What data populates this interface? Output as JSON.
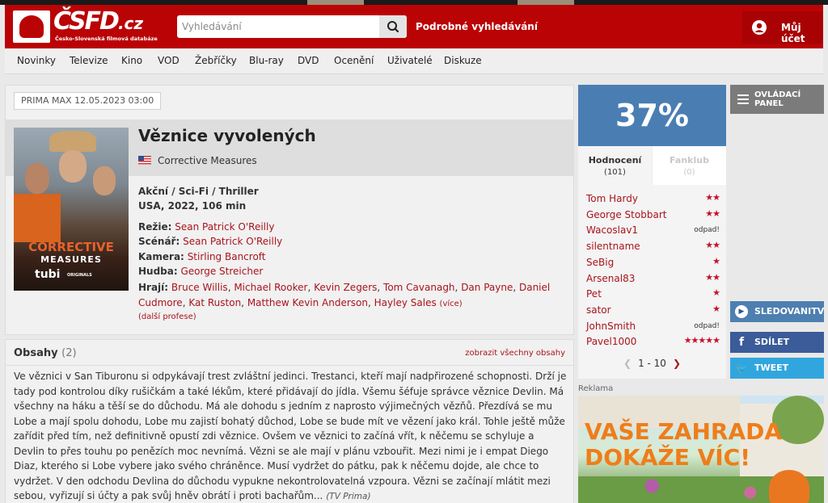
{
  "header": {
    "logo_text": "ČSFD",
    "logo_tld": ".cz",
    "logo_sub": "Česko-Slovenská filmová databáze",
    "search_placeholder": "Vyhledávání",
    "advanced_search": "Podrobné vyhledávání",
    "account": "Můj účet"
  },
  "nav": [
    "Novinky",
    "Televize",
    "Kino",
    "VOD",
    "Žebříčky",
    "Blu-ray",
    "DVD",
    "Ocenění",
    "Uživatelé",
    "Diskuze"
  ],
  "film": {
    "tv_badge": "PRIMA MAX 12.05.2023 03:00",
    "title": "Věznice vyvolených",
    "original_title": "Corrective Measures",
    "poster_title_1": "CORRECTIVE",
    "poster_title_2": "MEASURES",
    "poster_brand": "tubi",
    "poster_brand_sub": "ORIGINALS",
    "genres": "Akční / Sci-Fi / Thriller",
    "origin": "USA, 2022, 106 min",
    "crew": [
      {
        "label": "Režie:",
        "value": "Sean Patrick O'Reilly"
      },
      {
        "label": "Scénář:",
        "value": "Sean Patrick O'Reilly"
      },
      {
        "label": "Kamera:",
        "value": "Stirling Bancroft"
      },
      {
        "label": "Hudba:",
        "value": "George Streicher"
      }
    ],
    "actors_label": "Hrají:",
    "actors": [
      "Bruce Willis",
      "Michael Rooker",
      "Kevin Zegers",
      "Tom Cavanagh",
      "Dan Payne",
      "Daniel Cudmore",
      "Kat Ruston",
      "Matthew Kevin Anderson",
      "Hayley Sales"
    ],
    "actors_more": "(více)",
    "more_professions": "(další profese)"
  },
  "plot": {
    "title": "Obsahy",
    "count": "(2)",
    "all_link": "zobrazit všechny obsahy",
    "text": "Ve věznici v San Tiburonu si odpykávají trest zvláštní jedinci. Trestanci, kteří mají nadpřirozené schopnosti. Drží je tady pod kontrolou díky rušičkám a také lékům, které přidávají do jídla. Všemu šéfuje správce věznice Devlin. Má všechny na háku a těší se do důchodu. Má ale dohodu s jedním z naprosto výjimečných vězňů. Přezdívá se mu Lobe a mají spolu dohodu, Lobe mu zajistí bohatý důchod, Lobe se bude mít ve vězení jako král. Tohle ještě může zařídit před tím, než definitivně opustí zdi věznice. Ovšem ve věznici to začíná vřít, k něčemu se schyluje a Devlin to přes touhu po penězích moc nevnímá. Vězni se ale mají v plánu vzbouřit. Mezi nimi je i empat Diego Diaz, kterého si Lobe vybere jako svého chráněnce. Musí vydržet do pátku, pak k něčemu dojde, ale chce to vydržet. V den odchodu Devlina do důchodu vypukne nekontrolovatelná vzpoura. Vězni se začínají mlátit mezi sebou, vyřizují si účty a pak svůj hněv obrátí i proti bachařům...",
    "source": "(TV Prima)"
  },
  "rating": {
    "percent": "37%",
    "tab_ratings": "Hodnocení",
    "tab_ratings_count": "(101)",
    "tab_fanclub": "Fanklub",
    "tab_fanclub_count": "(0)",
    "users": [
      {
        "name": "Tom Hardy",
        "stars": 2,
        "text": ""
      },
      {
        "name": "George Stobbart",
        "stars": 2,
        "text": ""
      },
      {
        "name": "Wacoslav1",
        "stars": 0,
        "text": "odpad!"
      },
      {
        "name": "silentname",
        "stars": 2,
        "text": ""
      },
      {
        "name": "SeBig",
        "stars": 1,
        "text": ""
      },
      {
        "name": "Arsenal83",
        "stars": 2,
        "text": ""
      },
      {
        "name": "Pet",
        "stars": 1,
        "text": ""
      },
      {
        "name": "sator",
        "stars": 1,
        "text": ""
      },
      {
        "name": "JohnSmith",
        "stars": 0,
        "text": "odpad!"
      },
      {
        "name": "Pavel1000",
        "stars": 5,
        "text": ""
      }
    ],
    "pager": "1 - 10",
    "star_color": "#c8102e"
  },
  "sidebar": {
    "control_panel": "OVLÁDACÍ PANEL",
    "watch": "SLEDOVANITV",
    "share": "SDÍLET",
    "tweet": "TWEET"
  },
  "ad": {
    "label": "Reklama",
    "line1": "VAŠE ZAHRADA",
    "line2": "DOKÁŽE VÍC!"
  },
  "colors": {
    "brand_red": "#ba0305",
    "link_red": "#a8141c",
    "rating_blue": "#4a7eb3"
  }
}
